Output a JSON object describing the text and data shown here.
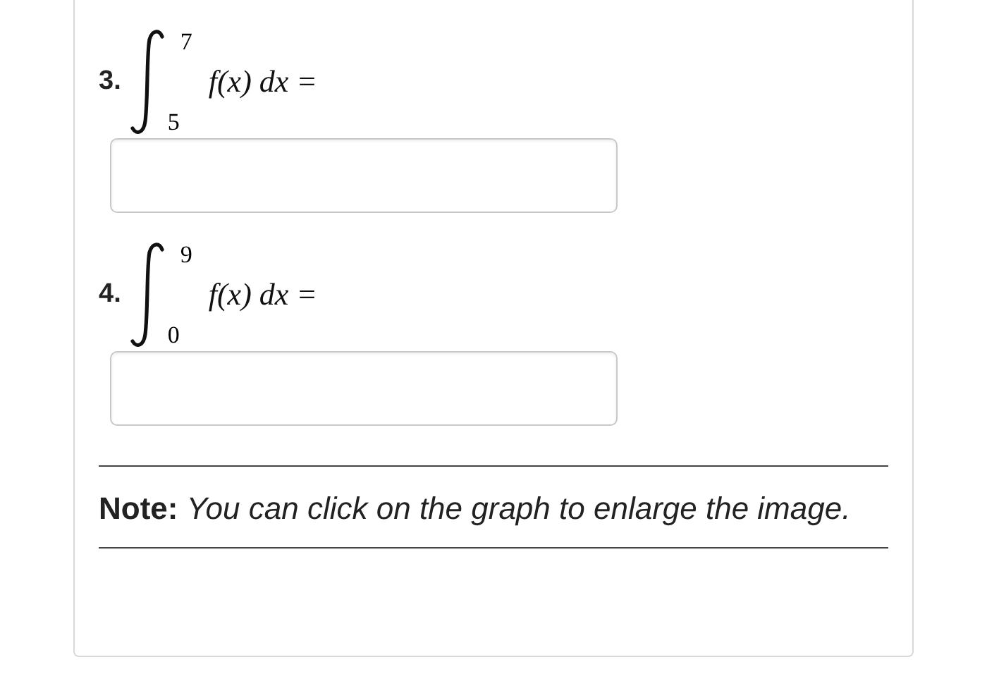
{
  "problems": [
    {
      "number": "3.",
      "upper": "7",
      "lower": "5",
      "integrand": "f(x) dx ="
    },
    {
      "number": "4.",
      "upper": "9",
      "lower": "0",
      "integrand": "f(x) dx ="
    }
  ],
  "note": "**Note:** *You can click on the graph to enlarge the image.*"
}
